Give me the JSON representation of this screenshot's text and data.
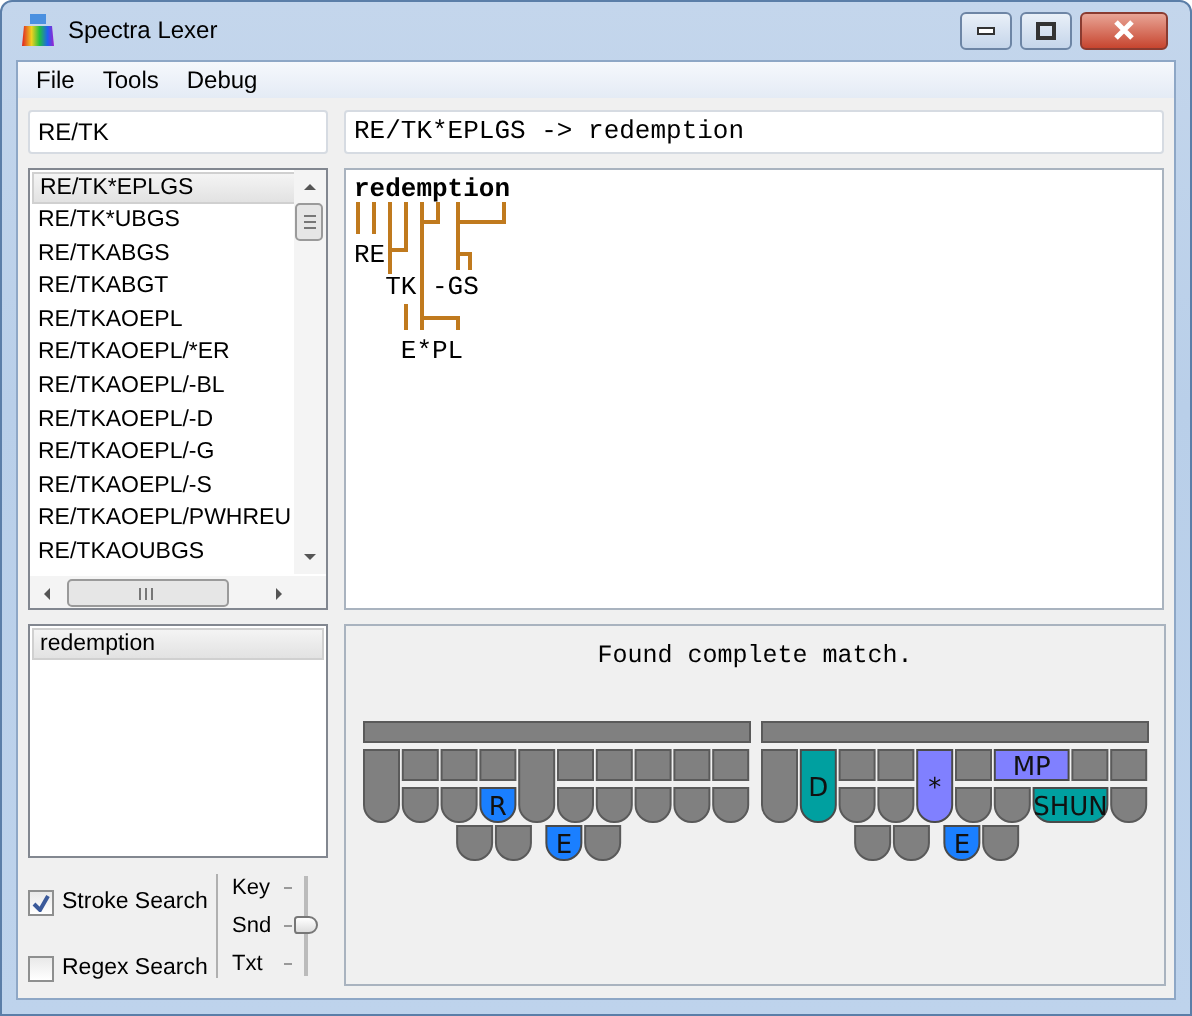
{
  "window": {
    "title": "Spectra Lexer"
  },
  "menu": [
    "File",
    "Tools",
    "Debug"
  ],
  "search": {
    "value": "RE/TK"
  },
  "title_field": {
    "value": "RE/TK*EPLGS -> redemption"
  },
  "stroke_list": [
    {
      "text": "RE/TK*EPLGS",
      "selected": true
    },
    {
      "text": "RE/TK*UBGS",
      "selected": false
    },
    {
      "text": "RE/TKABGS",
      "selected": false
    },
    {
      "text": "RE/TKABGT",
      "selected": false
    },
    {
      "text": "RE/TKAOEPL",
      "selected": false
    },
    {
      "text": "RE/TKAOEPL/*ER",
      "selected": false
    },
    {
      "text": "RE/TKAOEPL/-BL",
      "selected": false
    },
    {
      "text": "RE/TKAOEPL/-D",
      "selected": false
    },
    {
      "text": "RE/TKAOEPL/-G",
      "selected": false
    },
    {
      "text": "RE/TKAOEPL/-S",
      "selected": false
    },
    {
      "text": "RE/TKAOEPL/PWHREU",
      "selected": false
    },
    {
      "text": "RE/TKAOUBGS",
      "selected": false
    }
  ],
  "match_list": [
    {
      "text": "redemption",
      "selected": true
    }
  ],
  "options": [
    {
      "label": "Stroke Search",
      "checked": true
    },
    {
      "label": "Regex Search",
      "checked": false
    }
  ],
  "mode_slider": {
    "ticks": [
      "Key",
      "Snd",
      "Txt"
    ],
    "level": 0.5
  },
  "graph": {
    "nodes": [
      {
        "text": "redemption"
      },
      {
        "text": "RE"
      },
      {
        "text": "TK"
      },
      {
        "text": "-GS"
      },
      {
        "text": "E*PL"
      }
    ]
  },
  "board": {
    "caption": "Found complete match.",
    "strokes": [
      {
        "keys": [
          {
            "label": "R",
            "color": "#1a7fff"
          },
          {
            "label": "E",
            "color": "#1a7fff"
          }
        ]
      },
      {
        "keys": [
          {
            "label": "D",
            "color": "#00a0a0"
          },
          {
            "label": "*",
            "color": "#8080ff"
          },
          {
            "label": "MP",
            "color": "#8080ff"
          },
          {
            "label": "SHUN",
            "color": "#00a0a0"
          },
          {
            "label": "E",
            "color": "#1a7fff"
          }
        ]
      }
    ]
  }
}
